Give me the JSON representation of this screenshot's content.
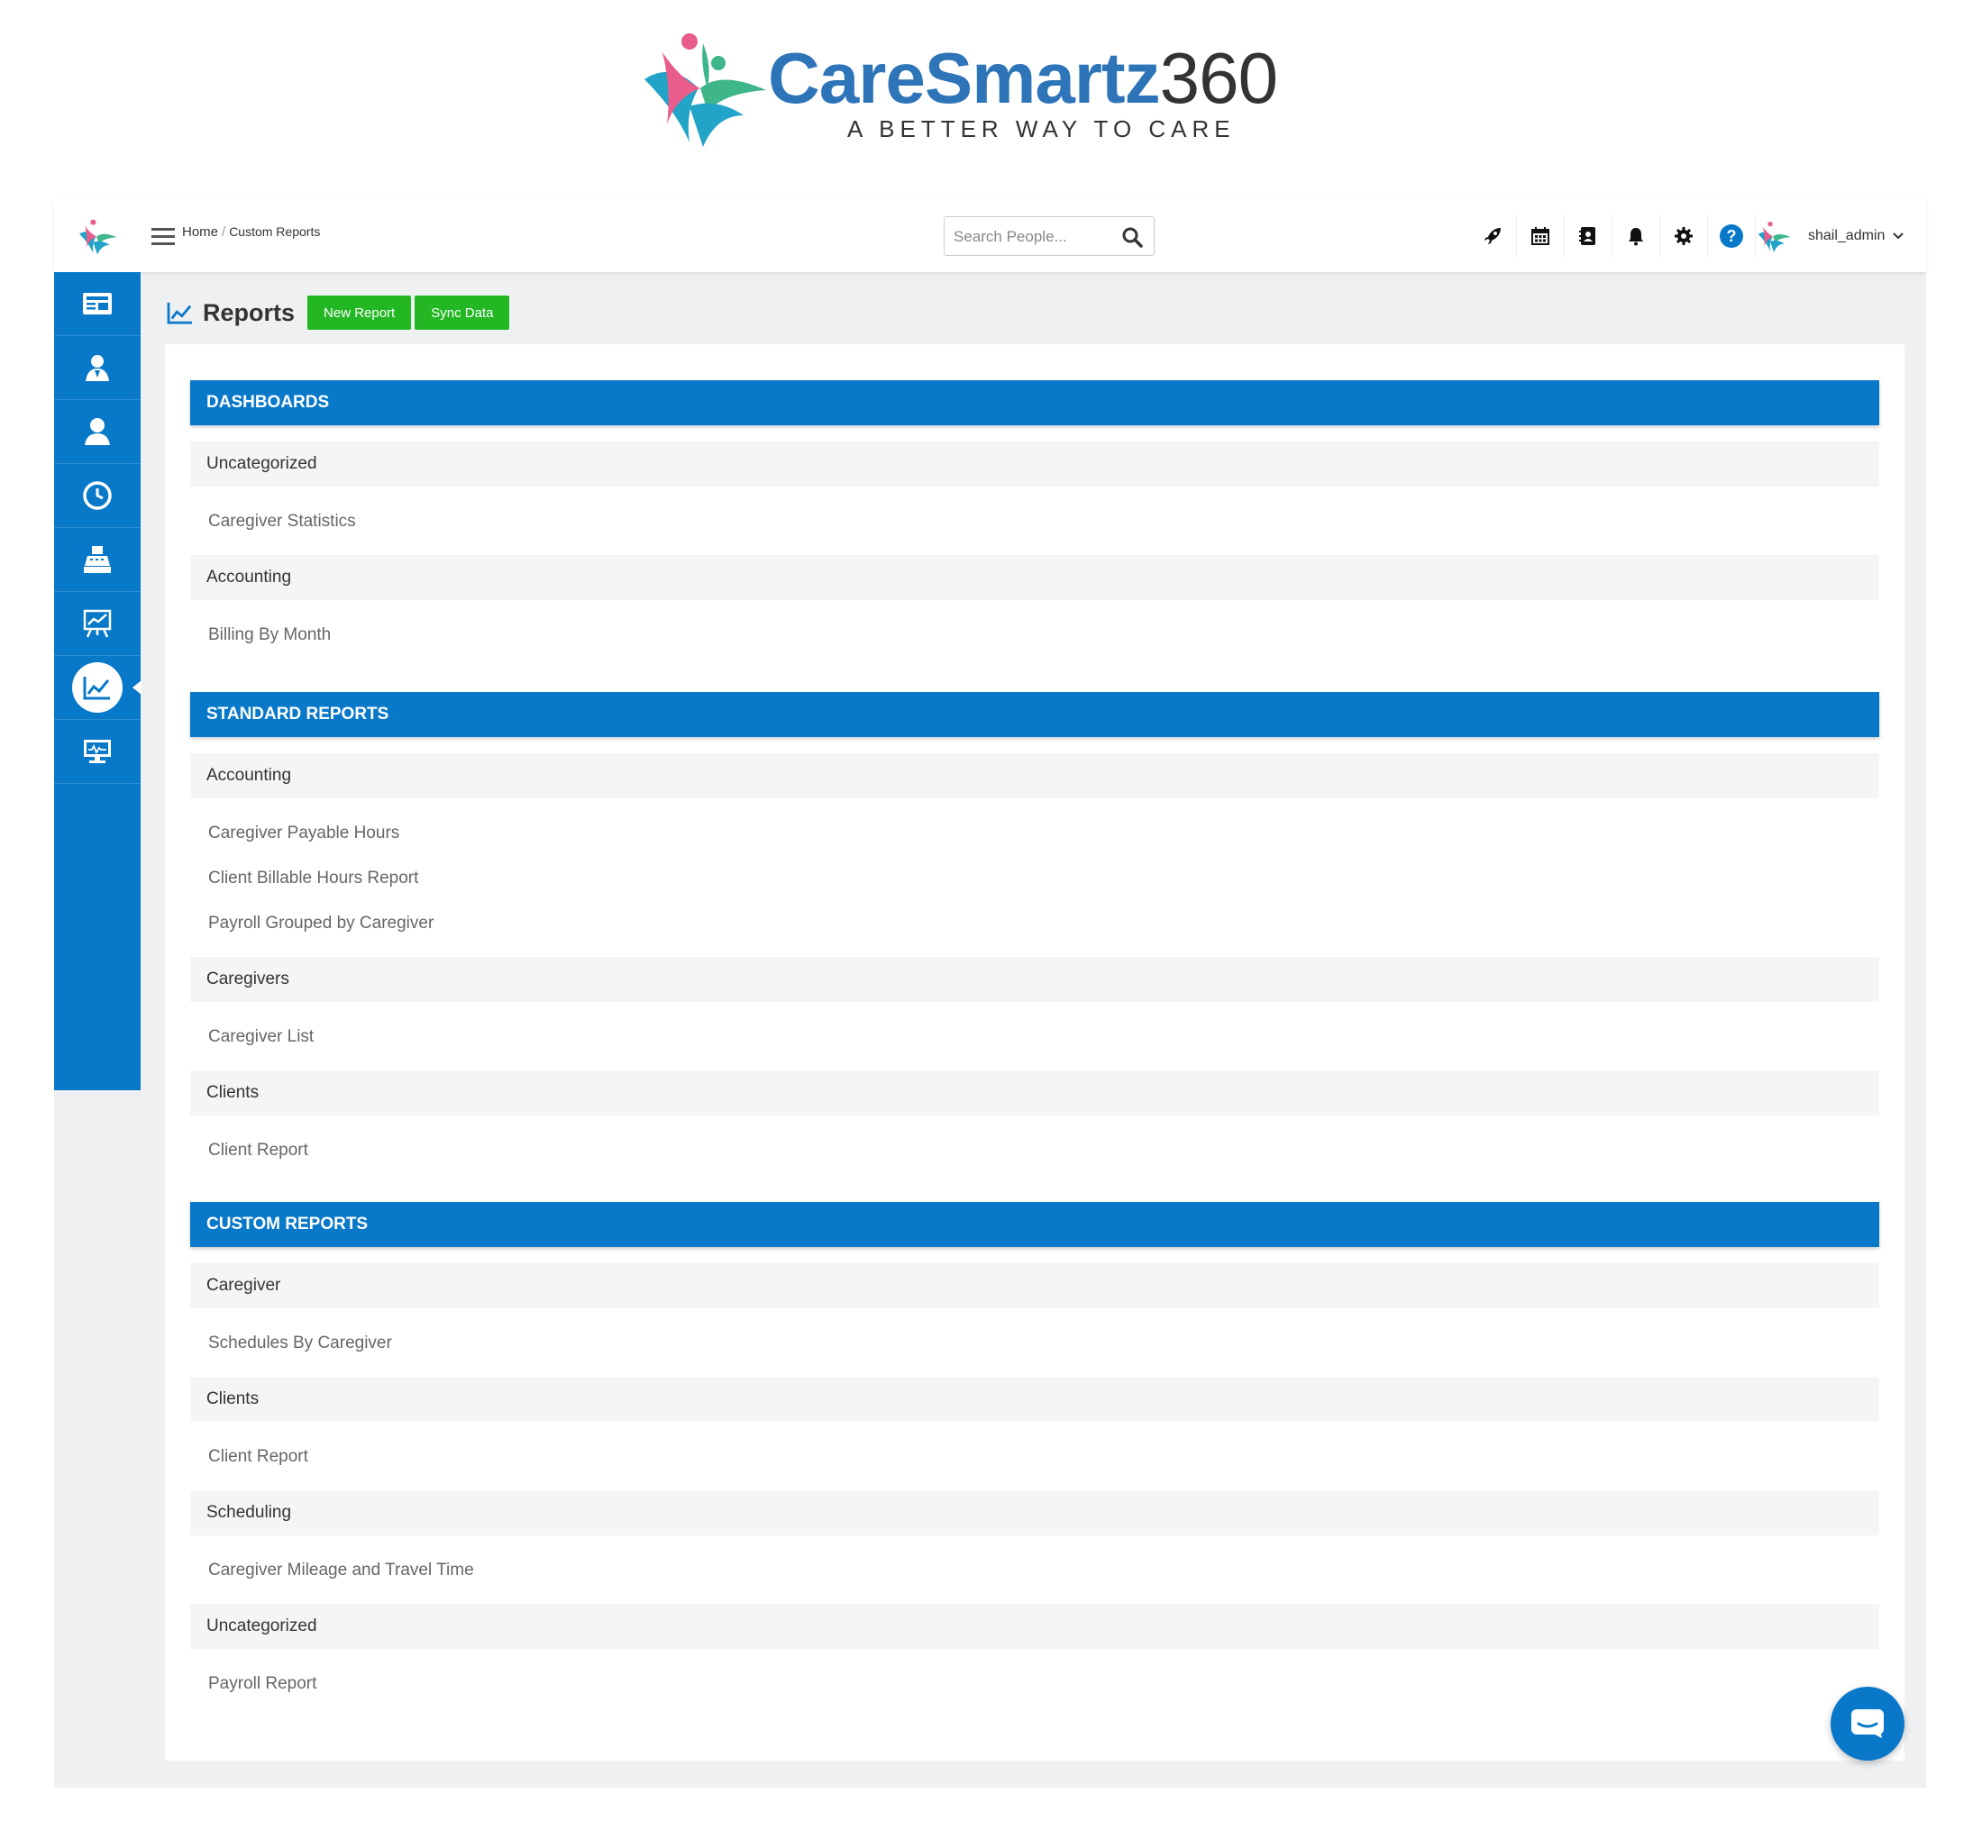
{
  "brand": {
    "name_part1": "CareSmartz",
    "name_part2": "360",
    "tagline": "A BETTER WAY TO CARE"
  },
  "topbar": {
    "breadcrumb": [
      "Home",
      "Custom Reports"
    ],
    "search_placeholder": "Search People...",
    "icons": [
      "rocket-icon",
      "calendar-icon",
      "contact-book-icon",
      "bell-icon",
      "gear-icon",
      "help-icon"
    ],
    "user_name": "shail_admin"
  },
  "sidebar": {
    "items": [
      "news-icon",
      "caregiver-icon",
      "client-icon",
      "clock-icon",
      "billing-icon",
      "presentation-chart-icon",
      "reports-chart-icon",
      "monitor-icon"
    ],
    "active": "reports-chart-icon"
  },
  "page": {
    "title": "Reports",
    "buttons": [
      "New Report",
      "Sync Data"
    ]
  },
  "sections": [
    {
      "title": "DASHBOARDS",
      "groups": [
        {
          "name": "Uncategorized",
          "items": [
            "Caregiver Statistics"
          ]
        },
        {
          "name": "Accounting",
          "items": [
            "Billing By Month"
          ]
        }
      ]
    },
    {
      "title": "STANDARD REPORTS",
      "groups": [
        {
          "name": "Accounting",
          "items": [
            "Caregiver Payable Hours",
            "Client Billable Hours Report",
            "Payroll Grouped by Caregiver"
          ]
        },
        {
          "name": "Caregivers",
          "items": [
            "Caregiver List"
          ]
        },
        {
          "name": "Clients",
          "items": [
            "Client Report"
          ]
        }
      ]
    },
    {
      "title": "CUSTOM REPORTS",
      "groups": [
        {
          "name": "Caregiver",
          "items": [
            "Schedules By Caregiver"
          ]
        },
        {
          "name": "Clients",
          "items": [
            "Client Report"
          ]
        },
        {
          "name": "Scheduling",
          "items": [
            "Caregiver Mileage and Travel Time"
          ]
        },
        {
          "name": "Uncategorized",
          "items": [
            "Payroll Report"
          ]
        }
      ]
    }
  ],
  "colors": {
    "primary_blue": "#0878c9",
    "green_button": "#23b823",
    "brand_blue": "#2e74b8",
    "background": "#eef0f2"
  }
}
